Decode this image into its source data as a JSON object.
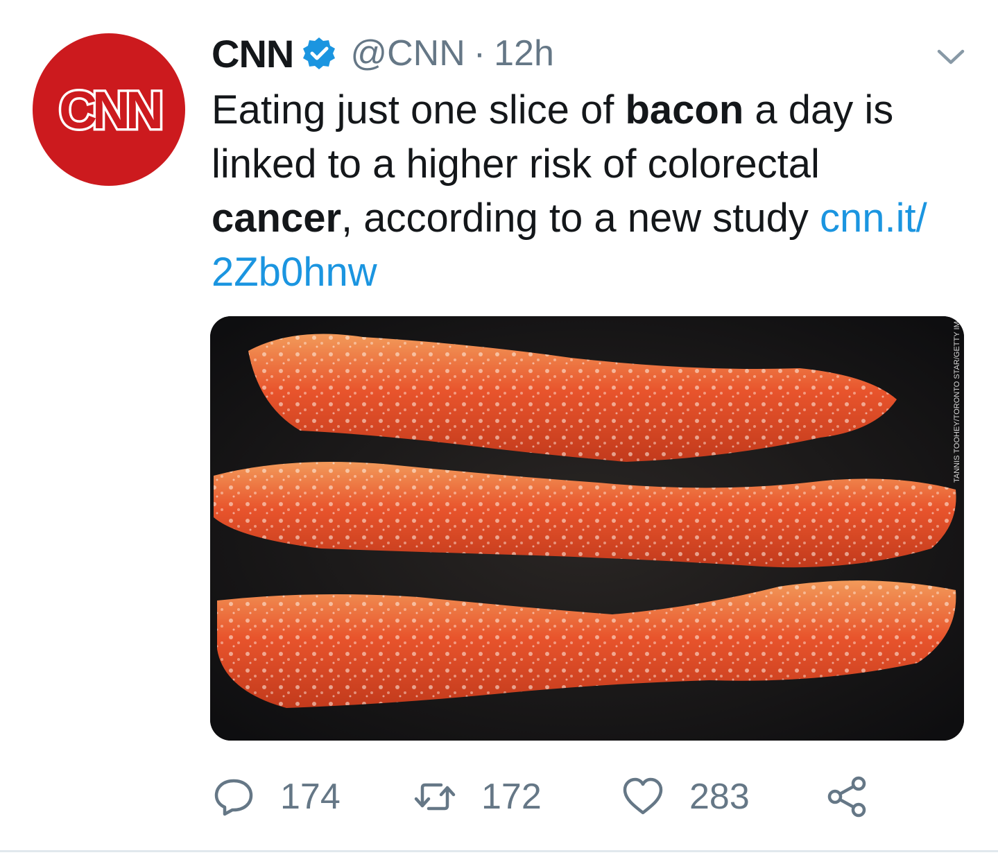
{
  "tweet": {
    "display_name": "CNN",
    "handle": "@CNN",
    "separator": "·",
    "time": "12h",
    "avatar_logo_text": "CNN",
    "text": {
      "part1": "Eating just one slice of ",
      "bold1": "bacon",
      "part2": " a day is linked to a higher risk of colorectal ",
      "bold2": "cancer",
      "part3": ", according to a new study ",
      "link": "cnn.it/ 2Zb0hnw"
    },
    "media": {
      "credit": "TANNIS TOOHEY/TORONTO STAR/GETTY IMAGES"
    },
    "actions": {
      "replies": "174",
      "retweets": "172",
      "likes": "283"
    }
  },
  "icons": {
    "verified": "verified-badge-icon",
    "caret": "chevron-down-icon",
    "reply": "reply-icon",
    "retweet": "retweet-icon",
    "like": "heart-icon",
    "share": "share-icon"
  },
  "colors": {
    "brand_red": "#cc1a1e",
    "link_blue": "#1b95e0",
    "muted_gray": "#657786",
    "text": "#14171a",
    "divider": "#e1e8ed"
  }
}
